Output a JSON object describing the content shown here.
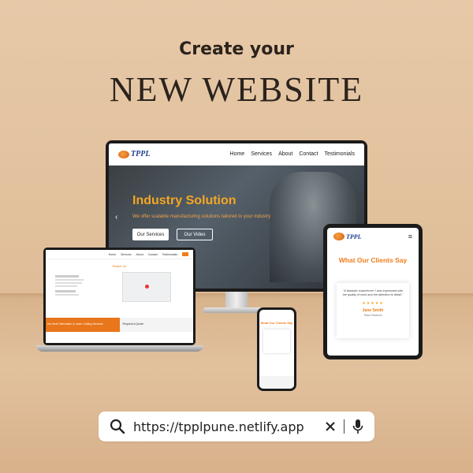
{
  "headline": "Create your",
  "title": "NEW WEBSITE",
  "desktop": {
    "logo": "TPPL",
    "nav": [
      "Home",
      "Services",
      "About",
      "Contact",
      "Testimonials"
    ],
    "hero_title": "Industry Solution",
    "hero_sub": "We offer scalable manufacturing solutions tailored to your industry",
    "btn_services": "Our Services",
    "btn_video": "Our Video"
  },
  "laptop": {
    "nav": [
      "Home",
      "Services",
      "About",
      "Contact",
      "Testimonials"
    ],
    "title": "Reach Us",
    "band_left": "Ins Heat Fabrication & Laser Cutting Services",
    "band_right": "Request A Quote"
  },
  "tablet": {
    "logo": "TPPL",
    "title": "What Our Clients Say",
    "quote": "\"A fantastic experience! I was impressed with the quality of work and the attention to detail.\"",
    "stars": "★★★★★",
    "name": "Jane Smith",
    "role": "Tesla Solutions"
  },
  "phone": {
    "title": "What Our Clients Say"
  },
  "search": {
    "url": "https://tpplpune.netlify.app",
    "icons": [
      "search-icon",
      "close-icon",
      "microphone-icon"
    ]
  },
  "colors": {
    "accent": "#f07c1a",
    "background": "#e7c9a8",
    "brand_blue": "#1d3f8c"
  }
}
